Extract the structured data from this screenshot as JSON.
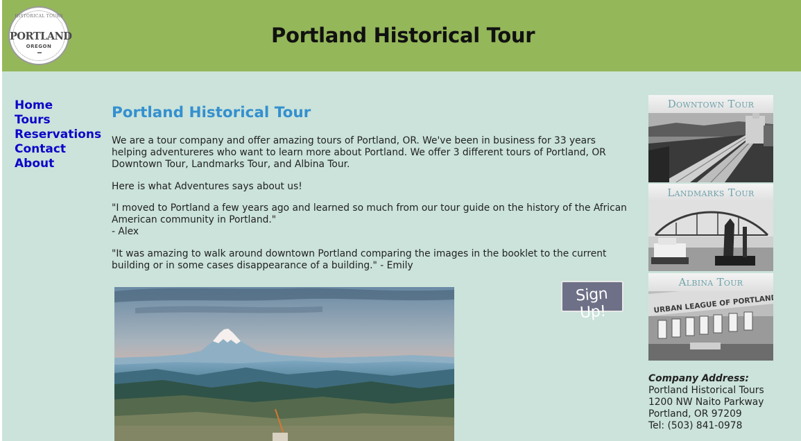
{
  "header": {
    "logo": {
      "arc_text": "HISTORICAL TOURS",
      "main_text": "PORTLAND",
      "sub_text": "OREGON"
    },
    "title": "Portland Historical Tour"
  },
  "nav": {
    "items": [
      {
        "label": "Home"
      },
      {
        "label": "Tours"
      },
      {
        "label": "Reservations"
      },
      {
        "label": "Contact"
      },
      {
        "label": "About"
      }
    ]
  },
  "main": {
    "heading": "Portland Historical Tour",
    "intro": "We are a tour company and offer amazing tours of Portland, OR. We've been in business for 33 years helping adventureres who want to learn more about Portland. We offer 3 different tours of Portland, OR Downtown Tour, Landmarks Tour, and Albina Tour.",
    "reviews_intro": "Here is what Adventures says about us!",
    "review1": {
      "quote": "\"I moved to Portland a few years ago and learned so much from our tour guide on the history of the African American community in Portland.\"",
      "author": "- Alex"
    },
    "review2": "\"It was amazing to walk around downtown Portland comparing the images in the booklet to the current building or in some cases disappearance of a building.\" - Emily"
  },
  "signup": {
    "label": "Sign Up!"
  },
  "tours": [
    {
      "label": "Downtown Tour"
    },
    {
      "label": "Landmarks Tour"
    },
    {
      "label": "Albina Tour"
    }
  ],
  "albina_sign": "URBAN LEAGUE OF PORTLAND",
  "address": {
    "heading": "Company Address:",
    "line1": "Portland Historical Tours",
    "line2": "1200 NW Naito Parkway",
    "line3": "Portland, OR 97209",
    "line4": "Tel: (503) 841-0978"
  },
  "colors": {
    "header_bg": "#94b75a",
    "page_bg": "#cbe3da",
    "nav_link": "#0d05c9",
    "heading_blue": "#3490cf"
  }
}
